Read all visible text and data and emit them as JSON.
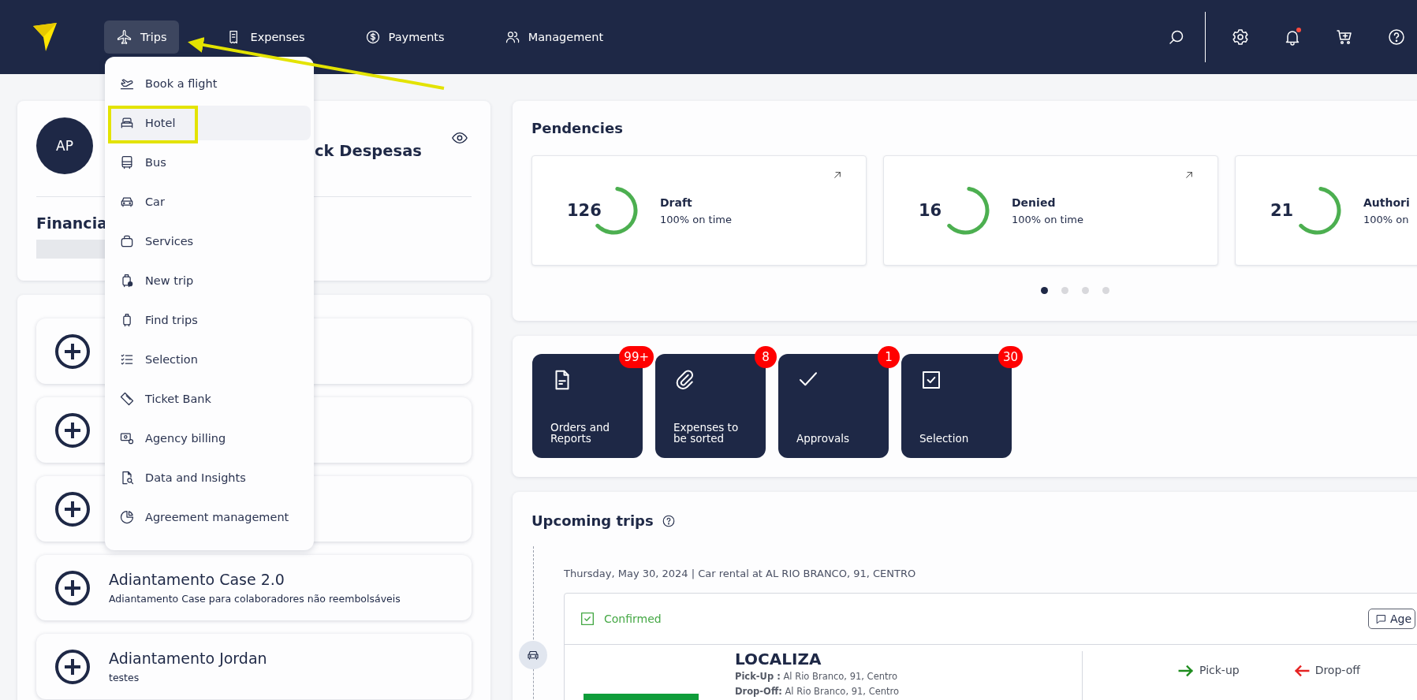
{
  "nav": {
    "items": [
      {
        "label": "Trips",
        "selected": true
      },
      {
        "label": "Expenses",
        "selected": false
      },
      {
        "label": "Payments",
        "selected": false
      },
      {
        "label": "Management",
        "selected": false
      }
    ],
    "notifications_unread": true
  },
  "trips_menu": {
    "items": [
      {
        "label": "Book a flight",
        "selected": false
      },
      {
        "label": "Hotel",
        "selected": true
      },
      {
        "label": "Bus",
        "selected": false
      },
      {
        "label": "Car",
        "selected": false
      },
      {
        "label": "Services",
        "selected": false
      },
      {
        "label": "New trip",
        "selected": false
      },
      {
        "label": "Find trips",
        "selected": false
      },
      {
        "label": "Selection",
        "selected": false
      },
      {
        "label": "Ticket Bank",
        "selected": false
      },
      {
        "label": "Agency billing",
        "selected": false
      },
      {
        "label": "Data and Insights",
        "selected": false
      },
      {
        "label": "Agreement management",
        "selected": false
      }
    ]
  },
  "profile": {
    "initials": "AP",
    "name": "ck Despesas",
    "section_title": "Financia"
  },
  "advances": [
    {
      "kind": "covered"
    },
    {
      "kind": "covered"
    },
    {
      "kind": "covered"
    },
    {
      "kind": "entry",
      "title": "Adiantamento Case 2.0",
      "description": "Adiantamento Case para colaboradores não reembolsáveis"
    },
    {
      "kind": "entry",
      "title": "Adiantamento Jordan",
      "description": "testes"
    }
  ],
  "pendencies": {
    "title": "Pendencies",
    "cards": [
      {
        "count": "126",
        "label": "Draft",
        "note": "100% on time",
        "level": 0.6
      },
      {
        "count": "16",
        "label": "Denied",
        "note": "100% on time",
        "level": 0.6
      },
      {
        "count": "21",
        "label": "Authori",
        "note": "100% on",
        "level": 0.6
      }
    ],
    "pages": [
      {
        "selected": true
      },
      {
        "selected": false
      },
      {
        "selected": false
      },
      {
        "selected": false
      }
    ]
  },
  "shortcuts": [
    {
      "label": "Orders and Reports",
      "badge": "99+"
    },
    {
      "label": "Expenses to be sorted",
      "badge": "8"
    },
    {
      "label": "Approvals",
      "badge": "1"
    },
    {
      "label": "Selection",
      "badge": "30"
    }
  ],
  "upcoming": {
    "title": "Upcoming trips",
    "date_line": "Thursday, May 30, 2024 | Car rental at AL RIO BRANCO, 91, CENTRO",
    "status": "Confirmed",
    "agency_button": "Age",
    "company": "LOCALIZA",
    "pickup": "**Pick-Up :** Al Rio Branco, 91, Centro",
    "dropoff": "**Drop-Off:** Al Rio Branco, 91, Centro",
    "legend": [
      {
        "label": "Pick-up",
        "color": "#1e8c1e"
      },
      {
        "label": "Drop-off",
        "color": "#e52222"
      }
    ]
  }
}
